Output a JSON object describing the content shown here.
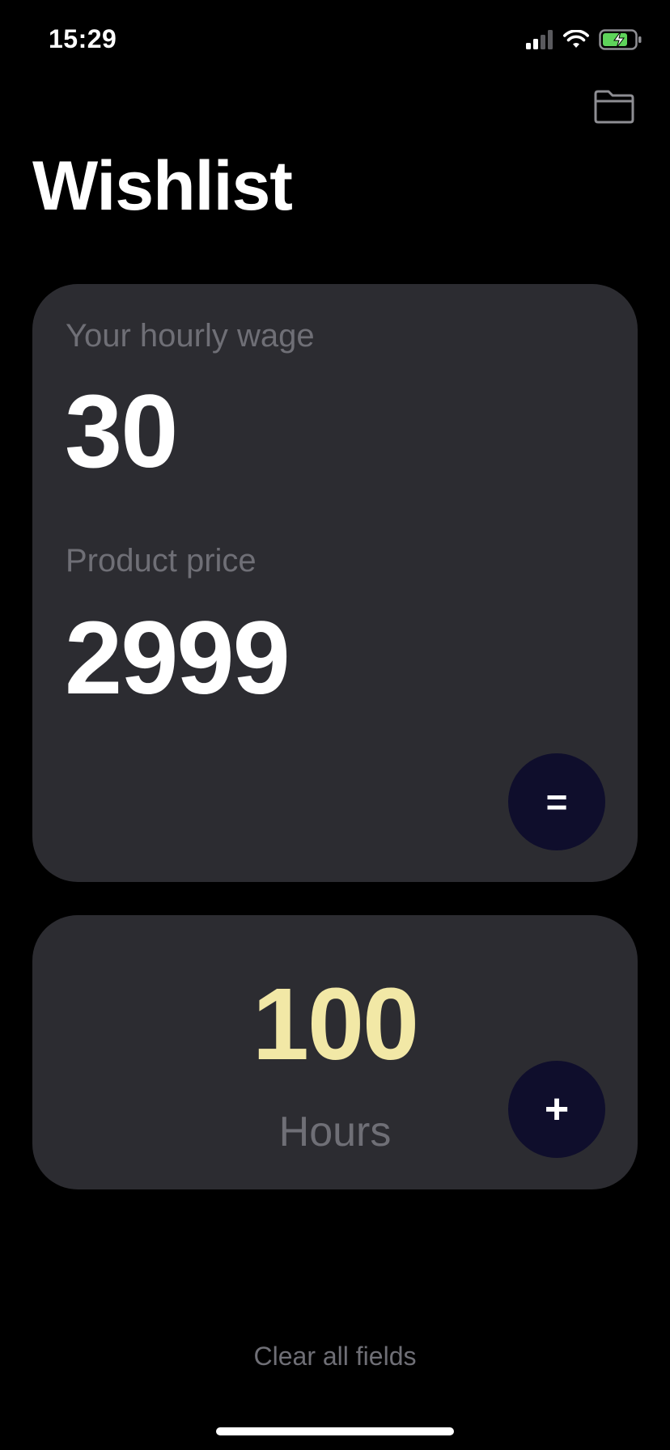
{
  "status_bar": {
    "time": "15:29",
    "icons": [
      "cellular-signal-icon",
      "wifi-icon",
      "battery-charging-icon"
    ]
  },
  "header": {
    "title": "Wishlist",
    "folder_icon": "folder-icon"
  },
  "input_card": {
    "wage_label": "Your hourly wage",
    "wage_value": "30",
    "price_label": "Product price",
    "price_value": "2999",
    "calculate_label": "="
  },
  "result_card": {
    "value": "100",
    "unit": "Hours",
    "add_label": "+"
  },
  "footer": {
    "clear_label": "Clear all fields"
  },
  "colors": {
    "background": "#000000",
    "card": "#2c2c31",
    "muted_text": "#6f6f76",
    "result_accent": "#f2e8a6",
    "button_bg": "#0f0e2c",
    "battery_green": "#5ed35a"
  }
}
